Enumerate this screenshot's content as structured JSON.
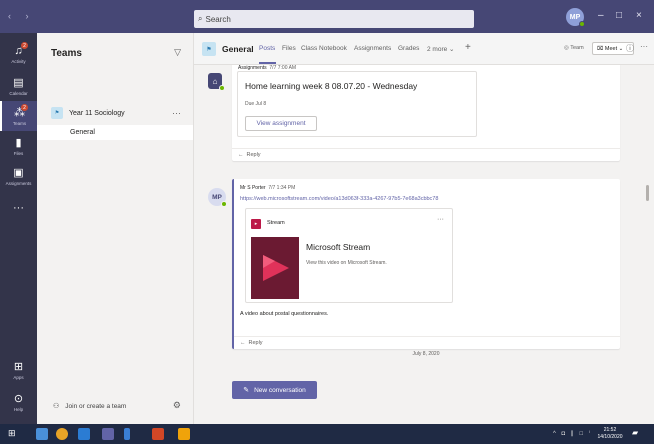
{
  "titlebar": {
    "search_placeholder": "Search",
    "user_initials": "MP",
    "minimize": "–",
    "maximize": "□",
    "close": "×"
  },
  "appbar": {
    "items": [
      {
        "label": "Activity",
        "icon": "bell-icon",
        "badge": "2"
      },
      {
        "label": "Calendar",
        "icon": "calendar-icon"
      },
      {
        "label": "Teams",
        "icon": "teams-icon",
        "badge": "2",
        "active": true
      },
      {
        "label": "Files",
        "icon": "file-icon"
      },
      {
        "label": "Assignments",
        "icon": "assignments-icon"
      },
      {
        "label": "Apps",
        "icon": "apps-icon"
      },
      {
        "label": "Help",
        "icon": "help-icon"
      }
    ],
    "more": "···"
  },
  "teams_panel": {
    "title": "Teams",
    "team_name": "Year 11 Sociology",
    "channel_name": "General",
    "join_label": "Join or create a team"
  },
  "channel_header": {
    "channel_name": "General",
    "tabs": [
      "Posts",
      "Files",
      "Class Notebook",
      "Assignments",
      "Grades",
      "2 more"
    ],
    "team_label": "Team",
    "meet_label": "Meet"
  },
  "feed": {
    "post1": {
      "author": "Assignments",
      "time": "7/7 7:00 AM",
      "title": "Home learning week 8 08.07.20 - Wednesday",
      "due": "Due Jul 8",
      "button": "View assignment",
      "reply": "Reply"
    },
    "post2": {
      "author": "Mr S Porter",
      "author_initials": "MP",
      "time": "7/7 1:34 PM",
      "link": "https://web.microsoftstream.com/video/a13d063f-333a-4267-97b5-7e68a3cbbc78",
      "stream_label": "Stream",
      "stream_title": "Microsoft Stream",
      "stream_desc": "View this video on Microsoft Stream.",
      "text": "A video about postal questionnaires.",
      "reply": "Reply"
    },
    "date_divider": "July 8, 2020"
  },
  "compose": {
    "new_conversation": "New conversation"
  },
  "taskbar": {
    "time": "21:52",
    "date": "14/10/2020",
    "tray": "^ ◘ ∥ □ ⁱ"
  },
  "colors": {
    "titlebar": "#464775",
    "appbar": "#33344a",
    "accent": "#6264a7",
    "presence": "#6bb700"
  }
}
